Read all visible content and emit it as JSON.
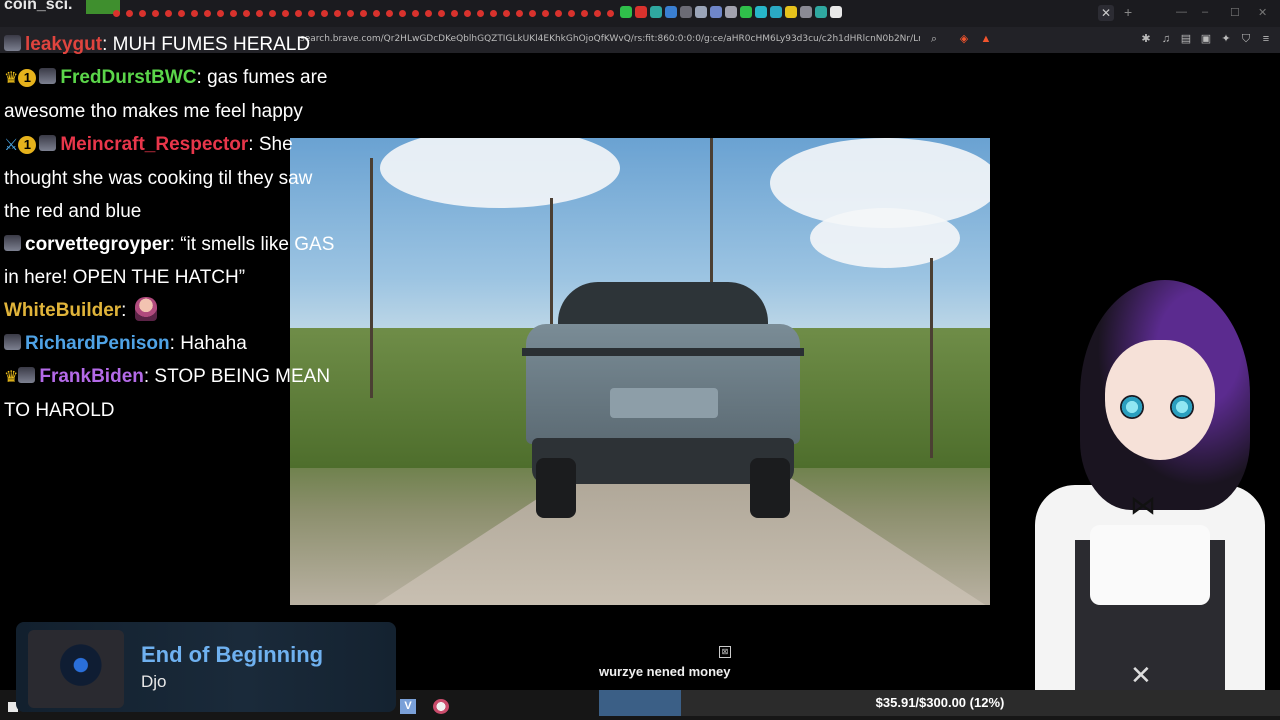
{
  "stream": {
    "top_partial_name": "coin_sci.",
    "url": "search.brave.com/Qr2HLwGDcDKeQblhGQZTIGLkUKl4EKhkGhOjoQfKWvQ/rs:fit:860:0:0:0/g:ce/aHR0cHM6Ly93d3cu/c2h1dHRlcnN0b2Nr/LmN..."
  },
  "chat": {
    "messages": [
      {
        "user": "leakygut",
        "color": "#e0443e",
        "text": ": MUH FUMES HERALD"
      },
      {
        "user": "FredDurstBWC",
        "color": "#5bd64a",
        "text": ": gas fumes are awesome tho makes me feel happy"
      },
      {
        "user": "Meincraft_Respector",
        "color": "#e8364a",
        "text": ": She thought she was cooking til they saw the red and blue"
      },
      {
        "user": "corvettegroyper",
        "color": "#ffffff",
        "text": ": “it smells like GAS in here! OPEN THE HATCH”"
      },
      {
        "user": "WhiteBuilder",
        "color": "#e0b43a",
        "text": ": "
      },
      {
        "user": "RichardPenison",
        "color": "#4fa3e6",
        "text": ": Hahaha"
      },
      {
        "user": "FrankBiden",
        "color": "#b46ae8",
        "text": ": STOP BEING MEAN TO HAROLD"
      }
    ]
  },
  "now_playing": {
    "title": "End of Beginning",
    "artist": "Djo"
  },
  "donation": {
    "label": "wurzye nened money",
    "goal_text": "$35.91/$300.00 (12%)",
    "progress": 0.12
  },
  "taskbar": {
    "vscode_label": "V"
  },
  "colors": {
    "accent_blue": "#6fb1f0",
    "tab_red": "#d9322d"
  }
}
